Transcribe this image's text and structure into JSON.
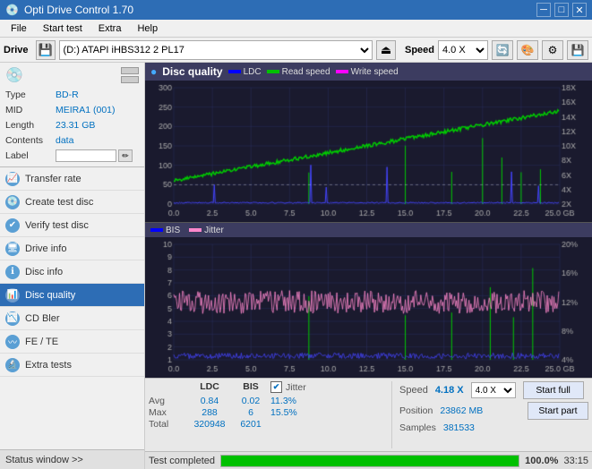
{
  "window": {
    "title": "Opti Drive Control 1.70",
    "icon": "💿"
  },
  "titlebar_controls": [
    "─",
    "□",
    "✕"
  ],
  "menu": {
    "items": [
      "File",
      "Start test",
      "Extra",
      "Help"
    ]
  },
  "drive_bar": {
    "label": "Drive",
    "drive_value": "(D:) ATAPI iHBS312  2 PL17",
    "speed_label": "Speed",
    "speed_value": "4.0 X"
  },
  "disc": {
    "title": "Disc",
    "rows": [
      {
        "label": "Type",
        "value": "BD-R",
        "colored": true
      },
      {
        "label": "MID",
        "value": "MEIRA1 (001)",
        "colored": true
      },
      {
        "label": "Length",
        "value": "23.31 GB",
        "colored": true
      },
      {
        "label": "Contents",
        "value": "data",
        "colored": true
      },
      {
        "label": "Label",
        "value": "",
        "colored": false,
        "is_input": true
      }
    ]
  },
  "nav": {
    "items": [
      {
        "label": "Transfer rate",
        "active": false
      },
      {
        "label": "Create test disc",
        "active": false
      },
      {
        "label": "Verify test disc",
        "active": false
      },
      {
        "label": "Drive info",
        "active": false
      },
      {
        "label": "Disc info",
        "active": false
      },
      {
        "label": "Disc quality",
        "active": true
      },
      {
        "label": "CD Bler",
        "active": false
      },
      {
        "label": "FE / TE",
        "active": false
      },
      {
        "label": "Extra tests",
        "active": false
      }
    ]
  },
  "status_window": {
    "label": "Status window >>",
    "bottom_text": "Test completed"
  },
  "disc_quality": {
    "title": "Disc quality",
    "legend": [
      {
        "label": "LDC",
        "color": "#0000ff"
      },
      {
        "label": "Read speed",
        "color": "#00c000"
      },
      {
        "label": "Write speed",
        "color": "#ff00ff"
      }
    ],
    "legend2": [
      {
        "label": "BIS",
        "color": "#0000ff"
      },
      {
        "label": "Jitter",
        "color": "#ff88cc"
      }
    ]
  },
  "stats": {
    "headers": [
      "",
      "LDC",
      "BIS",
      "",
      "Jitter",
      "Speed",
      ""
    ],
    "avg_label": "Avg",
    "max_label": "Max",
    "total_label": "Total",
    "ldc_avg": "0.84",
    "ldc_max": "288",
    "ldc_total": "320948",
    "bis_avg": "0.02",
    "bis_max": "6",
    "bis_total": "6201",
    "jitter_avg": "11.3%",
    "jitter_max": "15.5%",
    "jitter_checkbox": true,
    "speed_label": "Speed",
    "speed_val": "4.18 X",
    "speed_select": "4.0 X",
    "position_label": "Position",
    "position_val": "23862 MB",
    "samples_label": "Samples",
    "samples_val": "381533",
    "start_full_label": "Start full",
    "start_part_label": "Start part"
  },
  "progress": {
    "status": "Test completed",
    "percent": 100,
    "percent_label": "100.0%",
    "time": "33:15"
  },
  "chart_top": {
    "y_max": 300,
    "y_axis_labels": [
      "0",
      "50",
      "100",
      "150",
      "200",
      "250",
      "300"
    ],
    "y_axis_right_labels": [
      "2X",
      "4X",
      "6X",
      "8X",
      "10X",
      "12X",
      "14X",
      "16X",
      "18X"
    ],
    "x_labels": [
      "0.0",
      "2.5",
      "5.0",
      "7.5",
      "10.0",
      "12.5",
      "15.0",
      "17.5",
      "20.0",
      "22.5",
      "25.0 GB"
    ]
  },
  "chart_bottom": {
    "y_max": 10,
    "y_axis_labels": [
      "1",
      "2",
      "3",
      "4",
      "5",
      "6",
      "7",
      "8",
      "9",
      "10"
    ],
    "y_axis_right_labels": [
      "4%",
      "8%",
      "12%",
      "16%",
      "20%"
    ],
    "x_labels": [
      "0.0",
      "2.5",
      "5.0",
      "7.5",
      "10.0",
      "12.5",
      "15.0",
      "17.5",
      "20.0",
      "22.5",
      "25.0 GB"
    ]
  }
}
